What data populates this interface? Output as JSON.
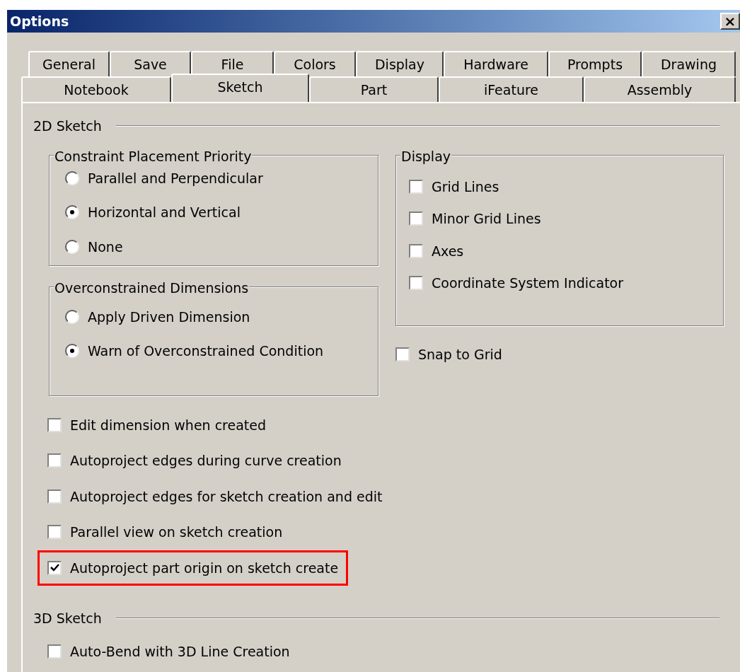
{
  "window": {
    "title": "Options",
    "close": "×"
  },
  "tab_rows": [
    [
      {
        "label": "General",
        "selected": false
      },
      {
        "label": "Save",
        "selected": false
      },
      {
        "label": "File",
        "selected": false
      },
      {
        "label": "Colors",
        "selected": false
      },
      {
        "label": "Display",
        "selected": false
      },
      {
        "label": "Hardware",
        "selected": false
      },
      {
        "label": "Prompts",
        "selected": false
      },
      {
        "label": "Drawing",
        "selected": false
      }
    ],
    [
      {
        "label": "Notebook",
        "selected": false
      },
      {
        "label": "Sketch",
        "selected": true
      },
      {
        "label": "Part",
        "selected": false
      },
      {
        "label": "iFeature",
        "selected": false
      },
      {
        "label": "Assembly",
        "selected": false
      }
    ]
  ],
  "sketch_2d": {
    "title": "2D Sketch",
    "constraint_placement_priority": {
      "title": "Constraint Placement Priority",
      "options": [
        {
          "label": "Parallel and Perpendicular",
          "selected": false
        },
        {
          "label": "Horizontal and Vertical",
          "selected": true
        },
        {
          "label": "None",
          "selected": false
        }
      ]
    },
    "overconstrained_dimensions": {
      "title": "Overconstrained Dimensions",
      "options": [
        {
          "label": "Apply Driven Dimension",
          "selected": false
        },
        {
          "label": "Warn of Overconstrained Condition",
          "selected": true
        }
      ]
    },
    "display": {
      "title": "Display",
      "options": [
        {
          "label": "Grid Lines",
          "checked": false
        },
        {
          "label": "Minor Grid Lines",
          "checked": false
        },
        {
          "label": "Axes",
          "checked": false
        },
        {
          "label": "Coordinate System Indicator",
          "checked": false
        }
      ]
    },
    "snap_to_grid": {
      "label": "Snap to Grid",
      "checked": false
    },
    "options": [
      {
        "label": "Edit dimension when created",
        "checked": false,
        "highlighted": false
      },
      {
        "label": "Autoproject edges during curve creation",
        "checked": false,
        "highlighted": false
      },
      {
        "label": "Autoproject edges for sketch creation and edit",
        "checked": false,
        "highlighted": false
      },
      {
        "label": "Parallel view on sketch creation",
        "checked": false,
        "highlighted": false
      },
      {
        "label": "Autoproject part origin on sketch create",
        "checked": true,
        "highlighted": true
      }
    ]
  },
  "sketch_3d": {
    "title": "3D Sketch",
    "options": [
      {
        "label": "Auto-Bend with 3D Line Creation",
        "checked": false
      }
    ]
  }
}
